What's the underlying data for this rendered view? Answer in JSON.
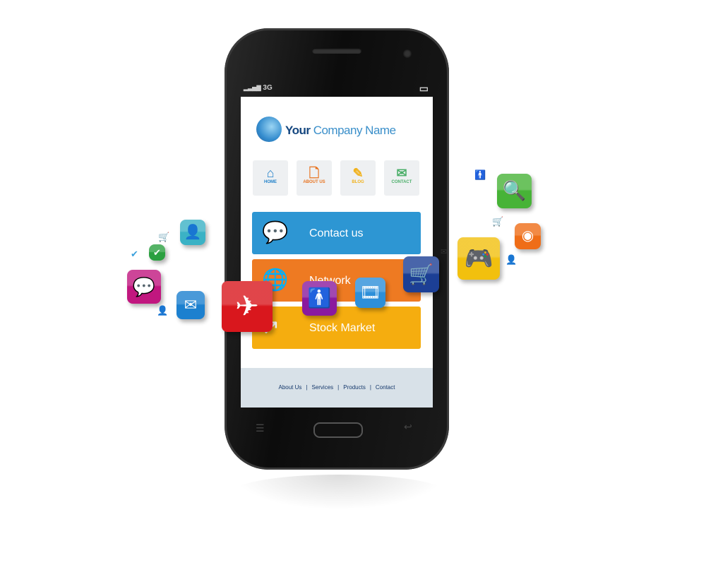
{
  "status": {
    "signal": "▂▃▅▇",
    "network": "3G",
    "battery": "▭"
  },
  "header": {
    "brand_bold": "Your",
    "brand_rest": "Company Name"
  },
  "nav": [
    {
      "label": "HOME",
      "icon": "house-icon",
      "glyph": "⌂",
      "color": "#1e7fc9"
    },
    {
      "label": "ABOUT US",
      "icon": "document-icon",
      "glyph": "🗋",
      "color": "#e8731f"
    },
    {
      "label": "BLOG",
      "icon": "notepad-pencil-icon",
      "glyph": "✎",
      "color": "#f1b21d"
    },
    {
      "label": "CONTACT",
      "icon": "phone-mail-icon",
      "glyph": "✉",
      "color": "#4caf6a"
    }
  ],
  "panels": [
    {
      "label": "Contact us",
      "icon": "speech-bubbles-icon",
      "glyph": "💬",
      "color": "#2d96d3"
    },
    {
      "label": "Network",
      "icon": "globe-icon",
      "glyph": "🌐",
      "color": "#ee7a22"
    },
    {
      "label": "Stock Market",
      "icon": "chart-arrow-icon",
      "glyph": "↗",
      "color": "#f5ad0f"
    }
  ],
  "footer": {
    "links": [
      "About Us",
      "Services",
      "Products",
      "Contact"
    ],
    "separator": "|"
  },
  "floating_icons": [
    {
      "name": "airplane-icon",
      "glyph": "✈",
      "color": "#d9171d"
    },
    {
      "name": "person-icon",
      "glyph": "🚹",
      "color": "#8a1a9e"
    },
    {
      "name": "film-icon",
      "glyph": "🎞",
      "color": "#2d8fd9"
    },
    {
      "name": "shopping-cart-icon",
      "glyph": "🛒",
      "color": "#1c3f95"
    },
    {
      "name": "gamepad-icon",
      "glyph": "🎮",
      "color": "#f2c00e"
    },
    {
      "name": "search-icon",
      "glyph": "🔍",
      "color": "#47b337"
    },
    {
      "name": "rss-icon",
      "glyph": "◉",
      "color": "#ef6d17"
    },
    {
      "name": "chat-icon",
      "glyph": "💬",
      "color": "#c1177f"
    },
    {
      "name": "mail-icon",
      "glyph": "✉",
      "color": "#1c80cf"
    },
    {
      "name": "contact-card-icon",
      "glyph": "👤",
      "color": "#3bb2c5"
    },
    {
      "name": "check-icon",
      "glyph": "✔",
      "color": "#2ba040"
    }
  ]
}
